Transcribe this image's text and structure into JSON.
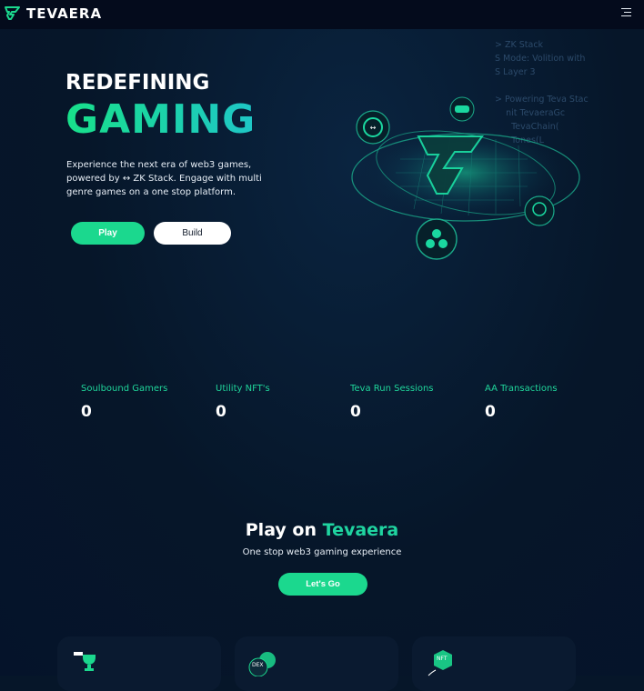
{
  "header": {
    "brand": "TEVAERA",
    "menu_icon": "hamburger-menu-icon"
  },
  "code_overlay": "> ZK Stack\nS Mode: Volition with\nS Layer 3\n\n> Powering Teva Stac\n    nit TevaeraGc\n      TevaChain(\n      Tones(L",
  "hero": {
    "title_line1": "REDEFINING",
    "title_line2": "GAMING",
    "description_1": "Experience the next era of web3 games, powered by",
    "description_2": "ZK Stack. Engage with multi genre games on a one stop platform.",
    "play_label": "Play",
    "build_label": "Build",
    "dex_label": "DEX",
    "nft_label": "NFT"
  },
  "stats": [
    {
      "label": "Soulbound Gamers",
      "value": "0"
    },
    {
      "label": "Utility NFT's",
      "value": "0"
    },
    {
      "label": "Teva Run Sessions",
      "value": "0"
    },
    {
      "label": "AA Transactions",
      "value": "0"
    }
  ],
  "play_section": {
    "title_prefix": "Play on",
    "title_accent": "Tevaera",
    "subtitle": "One stop web3 gaming experience",
    "cta_label": "Let's Go"
  },
  "cards": [
    {
      "icon": "trophy-icon"
    },
    {
      "icon": "dex-icon",
      "label": "DEX"
    },
    {
      "icon": "nft-icon",
      "label": "NFT"
    }
  ],
  "colors": {
    "accent": "#1bd88e",
    "background": "#061629",
    "topbar": "#040b1c"
  }
}
